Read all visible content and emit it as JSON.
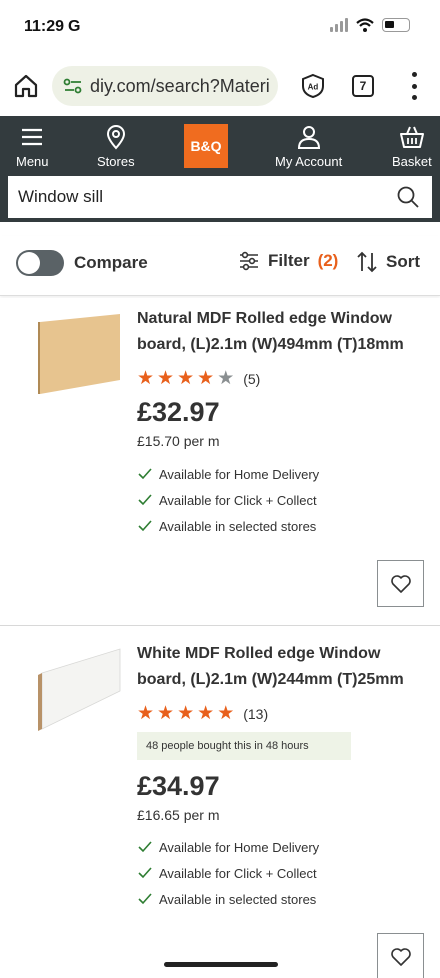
{
  "status_bar": {
    "time": "11:29",
    "app_indicator": "G"
  },
  "browser": {
    "url": "diy.com/search?Materi",
    "tab_count": "7",
    "icons": [
      "home-icon",
      "site-settings-icon",
      "adblock-icon",
      "tabs-icon",
      "more-vert-icon"
    ]
  },
  "header": {
    "menu_label": "Menu",
    "stores_label": "Stores",
    "logo_text": "B&Q",
    "account_label": "My Account",
    "basket_label": "Basket",
    "search_value": "Window sill",
    "header_bg": "#333b3e",
    "logo_color": "#f06c1f"
  },
  "toolbar": {
    "compare_label": "Compare",
    "compare_enabled": false,
    "filter_label": "Filter",
    "filter_count": "(2)",
    "sort_label": "Sort"
  },
  "products": [
    {
      "title": "Natural MDF Rolled edge Window board, (L)2.1m (W)494mm (T)18mm",
      "rating": 4,
      "rating_count": "(5)",
      "price": "£32.97",
      "unit_price": "£15.70 per m",
      "availability": [
        "Available for Home Delivery",
        "Available for Click + Collect",
        "Available in selected stores"
      ]
    },
    {
      "title": "White MDF Rolled edge Window board, (L)2.1m (W)244mm (T)25mm",
      "rating": 5,
      "rating_count": "(13)",
      "badge": "48 people bought this in 48 hours",
      "price": "£34.97",
      "unit_price": "£16.65 per m",
      "availability": [
        "Available for Home Delivery",
        "Available for Click + Collect",
        "Available in selected stores"
      ]
    }
  ],
  "colors": {
    "accent": "#e8601c",
    "check": "#2e7d32",
    "text": "#333333"
  }
}
